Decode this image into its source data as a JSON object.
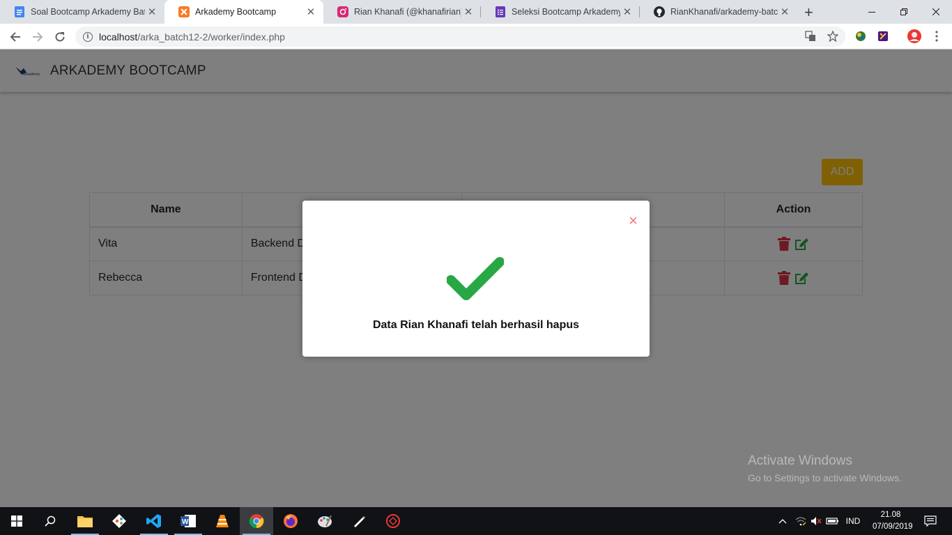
{
  "browser": {
    "tabs": [
      {
        "title": "Soal Bootcamp Arkademy Batc",
        "favicon": "google-docs-icon",
        "color": "#4285f4"
      },
      {
        "title": "Arkademy Bootcamp",
        "favicon": "xampp-icon",
        "color": "#fb7a24"
      },
      {
        "title": "Rian Khanafi (@khanafirian) • I",
        "favicon": "instagram-icon",
        "color": "#d62976"
      },
      {
        "title": "Seleksi Bootcamp Arkademy B",
        "favicon": "google-forms-icon",
        "color": "#673ab7"
      },
      {
        "title": "RianKhanafi/arkademy-batch-",
        "favicon": "github-icon",
        "color": "#24292e"
      }
    ],
    "active_tab": 1,
    "url_host": "localhost",
    "url_path": "/arka_batch12-2/worker/index.php"
  },
  "app": {
    "brand": "ARKADEMY BOOTCAMP",
    "logo_text": "arkademy",
    "add_label": "ADD",
    "table": {
      "headers": [
        "Name",
        "",
        "",
        "Action"
      ],
      "rows": [
        {
          "name": "Vita",
          "job": "Backend D"
        },
        {
          "name": "Rebecca",
          "job": "Frontend D"
        }
      ]
    }
  },
  "modal": {
    "close_glyph": "×",
    "message": "Data Rian Khanafi telah berhasil hapus",
    "icon": "success-check-icon",
    "icon_color": "#28a745"
  },
  "watermark": {
    "line1": "Activate Windows",
    "line2": "Go to Settings to activate Windows."
  },
  "taskbar": {
    "language": "IND",
    "time": "21.08",
    "date": "07/09/2019"
  },
  "colors": {
    "add_button": "#ffc107",
    "delete_icon": "#dc3545",
    "edit_icon": "#28a745",
    "close_x": "#f27474"
  }
}
